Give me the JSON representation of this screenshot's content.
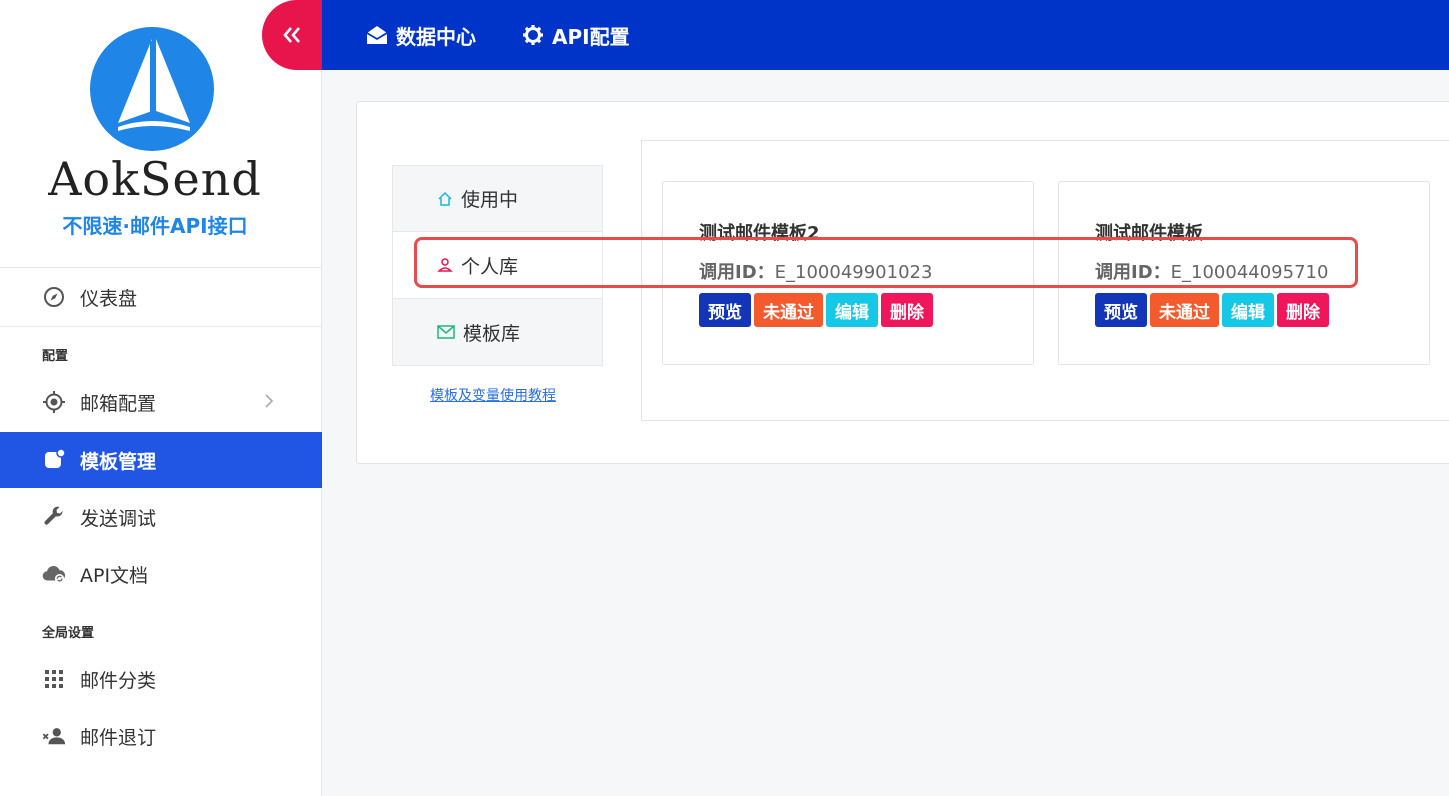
{
  "brand": {
    "name": "AokSend",
    "slogan": "不限速·邮件API接口",
    "color": "#1f86e8"
  },
  "topbar": {
    "items": [
      {
        "label": "数据中心",
        "icon": "envelope-open-icon"
      },
      {
        "label": "API配置",
        "icon": "gear-icon"
      }
    ],
    "color": "#0033c8"
  },
  "sidebar": {
    "collapse_icon": "double-chevron-left-icon",
    "dashboard": {
      "label": "仪表盘",
      "icon": "compass-icon"
    },
    "section_config": "配置",
    "mailbox": {
      "label": "邮箱配置",
      "icon": "target-icon"
    },
    "template": {
      "label": "模板管理",
      "icon": "app-badge-icon",
      "active": true
    },
    "send_test": {
      "label": "发送调试",
      "icon": "wrench-icon"
    },
    "api_docs": {
      "label": "API文档",
      "icon": "cloud-sync-icon"
    },
    "section_global": "全局设置",
    "categories": {
      "label": "邮件分类",
      "icon": "grid-icon"
    },
    "unsubscribe": {
      "label": "邮件退订",
      "icon": "user-remove-icon"
    },
    "active_color": "#2155e4"
  },
  "tabs": [
    {
      "label": "使用中",
      "icon": "home-icon"
    },
    {
      "label": "个人库",
      "icon": "user-icon"
    },
    {
      "label": "模板库",
      "icon": "mail-icon"
    }
  ],
  "tutorial_link": "模板及变量使用教程",
  "cards": [
    {
      "title": "测试邮件模板2",
      "id_label": "调用ID：",
      "id_value": "E_100049901023",
      "buttons": {
        "preview": "预览",
        "status": "未通过",
        "edit": "编辑",
        "delete": "删除"
      }
    },
    {
      "title": "测试邮件模板",
      "id_label": "调用ID：",
      "id_value": "E_100044095710",
      "buttons": {
        "preview": "预览",
        "status": "未通过",
        "edit": "编辑",
        "delete": "删除"
      }
    }
  ],
  "button_colors": {
    "preview": "#1336b8",
    "status": "#f35a2e",
    "edit": "#16c8e6",
    "delete": "#ef165b"
  },
  "highlight_color": "#e84b4b"
}
